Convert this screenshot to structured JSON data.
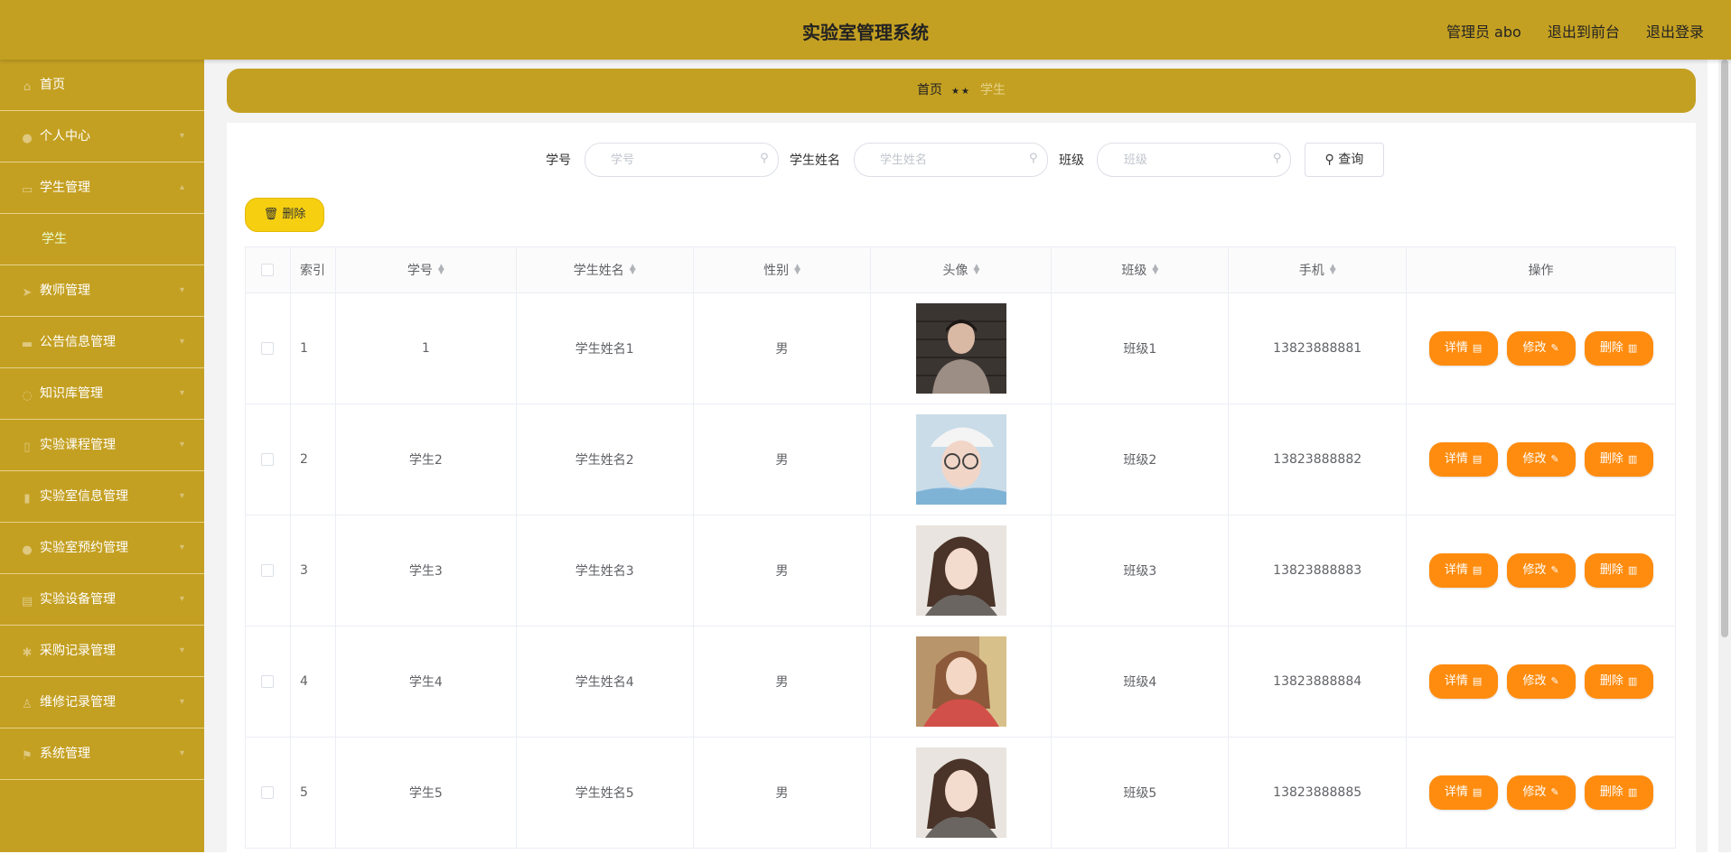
{
  "header": {
    "title": "实验室管理系统",
    "admin": "管理员 abo",
    "front_link": "退出到前台",
    "logout_link": "退出登录"
  },
  "sidebar": {
    "items": [
      {
        "label": "首页",
        "icon": "home-icon"
      },
      {
        "label": "个人中心",
        "icon": "user-icon"
      },
      {
        "label": "学生管理",
        "icon": "folder-icon",
        "children": [
          {
            "label": "学生"
          }
        ]
      },
      {
        "label": "教师管理",
        "icon": "send-icon"
      },
      {
        "label": "公告信息管理",
        "icon": "card-icon"
      },
      {
        "label": "知识库管理",
        "icon": "bulb-icon"
      },
      {
        "label": "实验课程管理",
        "icon": "book-icon"
      },
      {
        "label": "实验室信息管理",
        "icon": "chart-icon"
      },
      {
        "label": "实验室预约管理",
        "icon": "user-icon"
      },
      {
        "label": "实验设备管理",
        "icon": "device-icon"
      },
      {
        "label": "采购记录管理",
        "icon": "gear-icon"
      },
      {
        "label": "维修记录管理",
        "icon": "wrench-icon"
      },
      {
        "label": "系统管理",
        "icon": "flag-icon"
      }
    ]
  },
  "breadcrumb": {
    "home": "首页",
    "sep": "★★",
    "current": "学生"
  },
  "search": {
    "f1_label": "学号",
    "f1_placeholder": "学号",
    "f2_label": "学生姓名",
    "f2_placeholder": "学生姓名",
    "f3_label": "班级",
    "f3_placeholder": "班级",
    "button": "查询"
  },
  "toolbar": {
    "delete_label": "删除"
  },
  "table": {
    "headers": {
      "index": "索引",
      "no": "学号",
      "name": "学生姓名",
      "gender": "性别",
      "avatar": "头像",
      "class": "班级",
      "phone": "手机",
      "ops": "操作"
    },
    "rows": [
      {
        "index": "1",
        "no": "1",
        "name": "学生姓名1",
        "gender": "男",
        "class": "班级1",
        "phone": "13823888881"
      },
      {
        "index": "2",
        "no": "学生2",
        "name": "学生姓名2",
        "gender": "男",
        "class": "班级2",
        "phone": "13823888882"
      },
      {
        "index": "3",
        "no": "学生3",
        "name": "学生姓名3",
        "gender": "男",
        "class": "班级3",
        "phone": "13823888883"
      },
      {
        "index": "4",
        "no": "学生4",
        "name": "学生姓名4",
        "gender": "男",
        "class": "班级4",
        "phone": "13823888884"
      },
      {
        "index": "5",
        "no": "学生5",
        "name": "学生姓名5",
        "gender": "男",
        "class": "班级5",
        "phone": "13823888885"
      }
    ],
    "actions": {
      "detail": "详情",
      "edit": "修改",
      "delete": "删除"
    }
  },
  "colors": {
    "theme": "#c4a022",
    "action": "#ff8c0f",
    "delete_btn": "#f5cf10"
  }
}
